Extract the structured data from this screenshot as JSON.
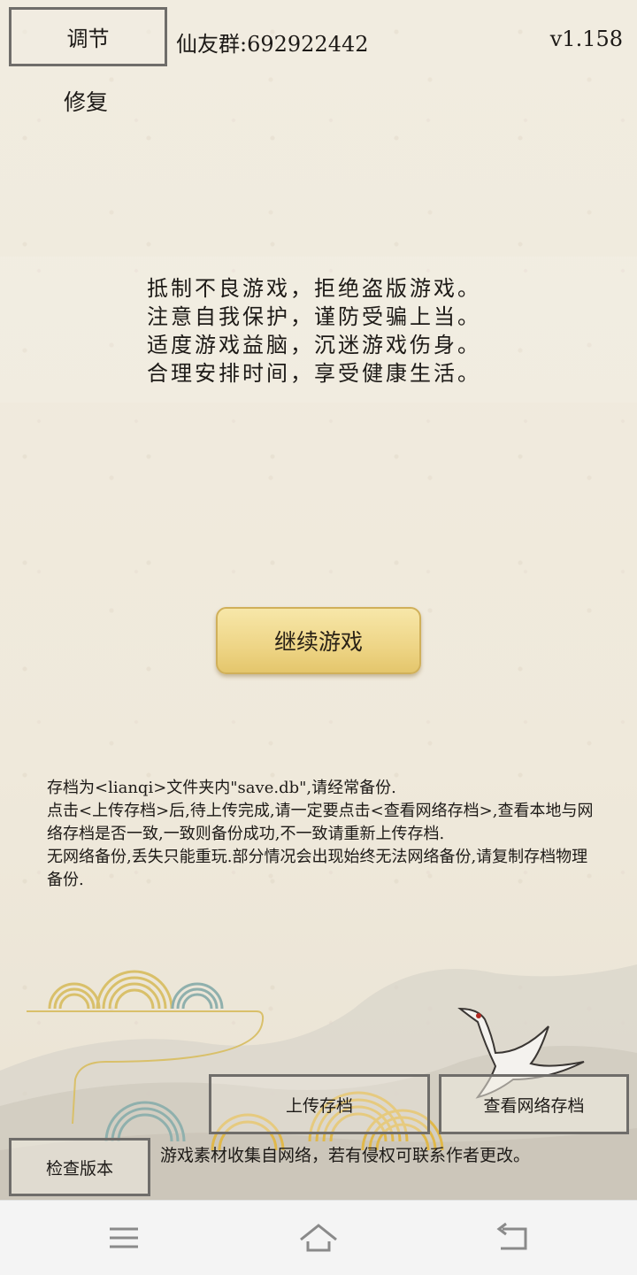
{
  "header": {
    "adjust_label": "调节",
    "group_text": "仙友群:692922442",
    "version": "v1.158",
    "repair_label": "修复"
  },
  "notice": {
    "lines": [
      "抵制不良游戏，拒绝盗版游戏。",
      "注意自我保护，谨防受骗上当。",
      "适度游戏益脑，沉迷游戏伤身。",
      "合理安排时间，享受健康生活。"
    ]
  },
  "main": {
    "continue_label": "继续游戏"
  },
  "info": {
    "lines": [
      "存档为<lianqi>文件夹内\"save.db\",请经常备份.",
      "点击<上传存档>后,待上传完成,请一定要点击<查看网络存档>,查看本地与网络存档是否一致,一致则备份成功,不一致请重新上传存档.",
      "无网络备份,丢失只能重玩.部分情况会出现始终无法网络备份,请复制存档物理备份."
    ]
  },
  "bottom": {
    "upload_label": "上传存档",
    "cloud_label": "查看网络存档",
    "check_version_label": "检查版本",
    "disclaimer": "游戏素材收集自网络，若有侵权可联系作者更改。"
  },
  "navbar": {
    "icons": [
      "menu-icon",
      "home-icon",
      "back-icon"
    ]
  },
  "colors": {
    "paper": "#efe9db",
    "button_gold": "#eed586",
    "border_gray": "#6f6d6a"
  }
}
